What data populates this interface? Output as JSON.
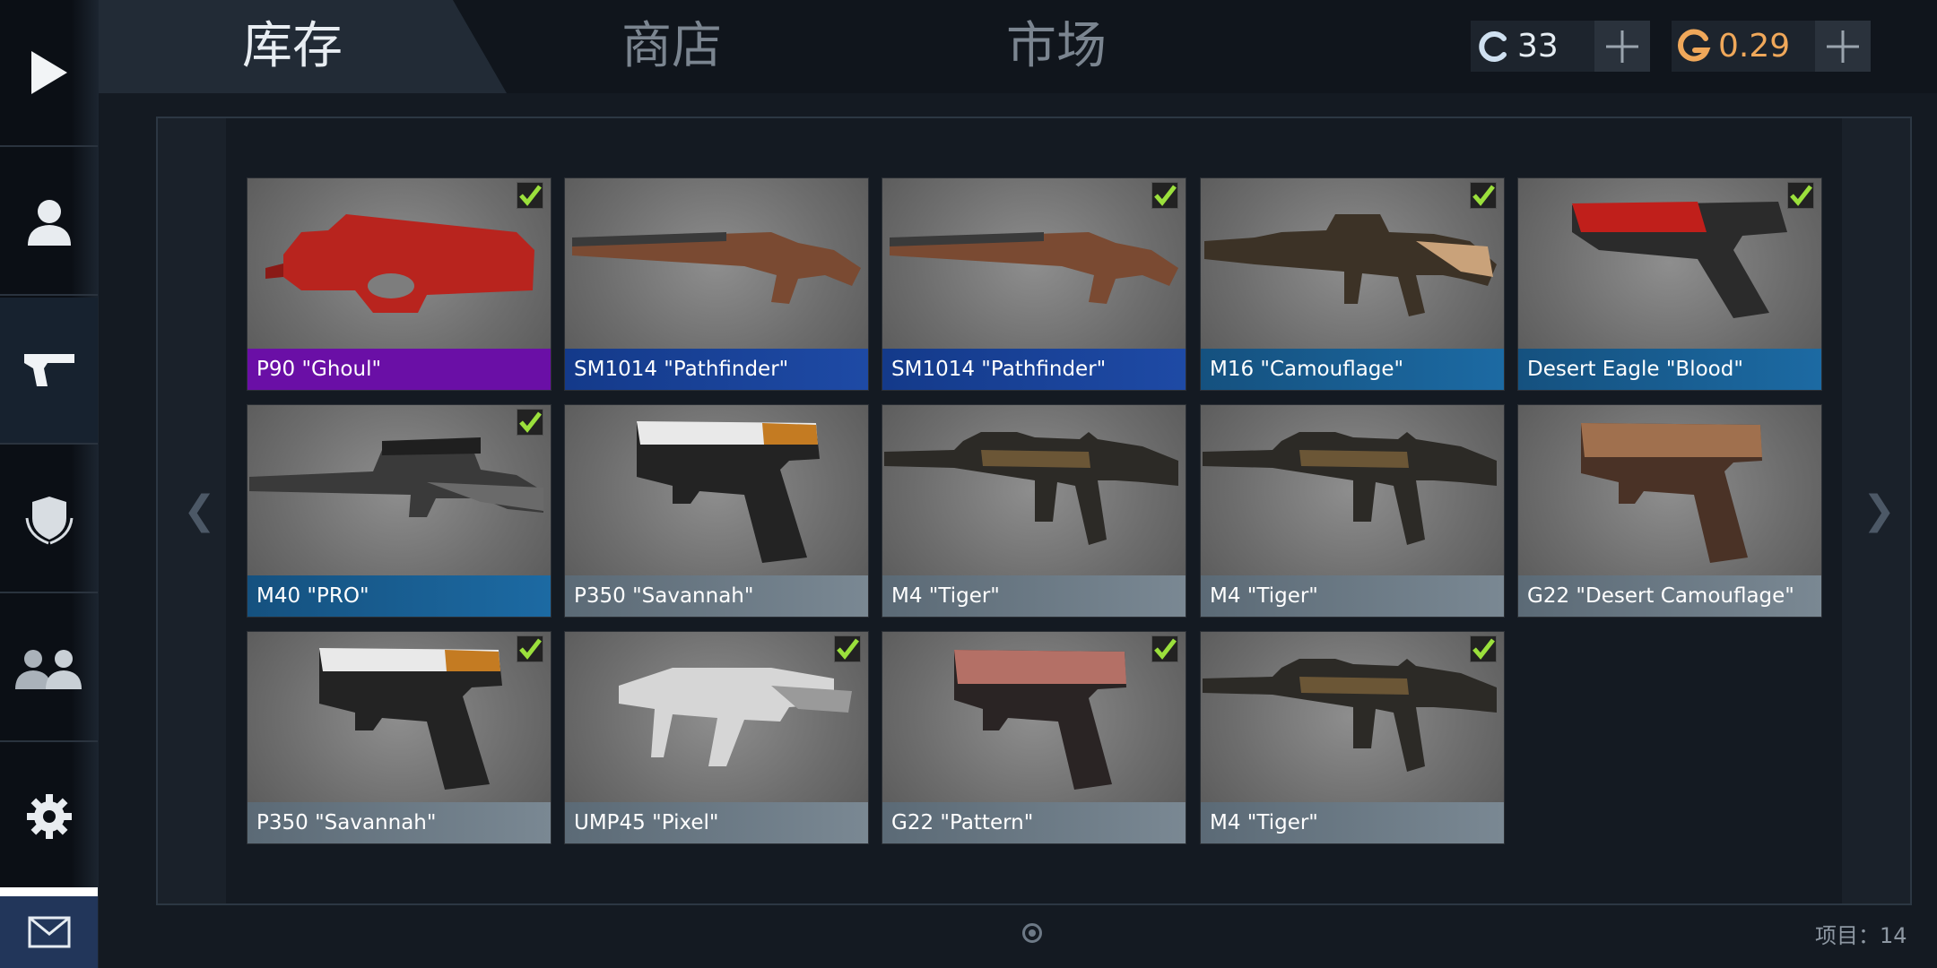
{
  "tabs": {
    "inventory": "库存",
    "shop": "商店",
    "market": "市场"
  },
  "currency": {
    "credits": "33",
    "gold": "0.29",
    "credits_color": "#cfe0f0",
    "gold_color": "#f0a85a"
  },
  "sidebar": [
    "play-icon",
    "profile-icon",
    "weapon-icon",
    "clan-shield-icon",
    "friends-icon",
    "settings-icon",
    "mail-icon"
  ],
  "cards": [
    {
      "name": "P90 \"Ghoul\"",
      "rarity": "purple",
      "checked": true,
      "kind": "smg"
    },
    {
      "name": "SM1014 \"Pathfinder\"",
      "rarity": "blue",
      "checked": false,
      "kind": "shotgun"
    },
    {
      "name": "SM1014 \"Pathfinder\"",
      "rarity": "blue",
      "checked": true,
      "kind": "shotgun"
    },
    {
      "name": "M16 \"Camouflage\"",
      "rarity": "teal",
      "checked": true,
      "kind": "rifle-tan"
    },
    {
      "name": "Desert Eagle \"Blood\"",
      "rarity": "teal",
      "checked": true,
      "kind": "deagle"
    },
    {
      "name": "M40 \"PRO\"",
      "rarity": "teal",
      "checked": true,
      "kind": "sniper"
    },
    {
      "name": "P350 \"Savannah\"",
      "rarity": "gray",
      "checked": false,
      "kind": "pistol-orange"
    },
    {
      "name": "M4 \"Tiger\"",
      "rarity": "gray",
      "checked": false,
      "kind": "rifle-dark"
    },
    {
      "name": "M4 \"Tiger\"",
      "rarity": "gray",
      "checked": false,
      "kind": "rifle-dark"
    },
    {
      "name": "G22 \"Desert Camouflage\"",
      "rarity": "gray",
      "checked": false,
      "kind": "glock-brown"
    },
    {
      "name": "P350 \"Savannah\"",
      "rarity": "gray",
      "checked": true,
      "kind": "pistol-orange"
    },
    {
      "name": "UMP45 \"Pixel\"",
      "rarity": "gray",
      "checked": true,
      "kind": "ump"
    },
    {
      "name": "G22 \"Pattern\"",
      "rarity": "gray",
      "checked": true,
      "kind": "glock-pink"
    },
    {
      "name": "M4 \"Tiger\"",
      "rarity": "gray",
      "checked": true,
      "kind": "rifle-dark"
    }
  ],
  "nav": {
    "prev": "❮",
    "next": "❯"
  },
  "footer": {
    "items_label": "项目：14"
  }
}
